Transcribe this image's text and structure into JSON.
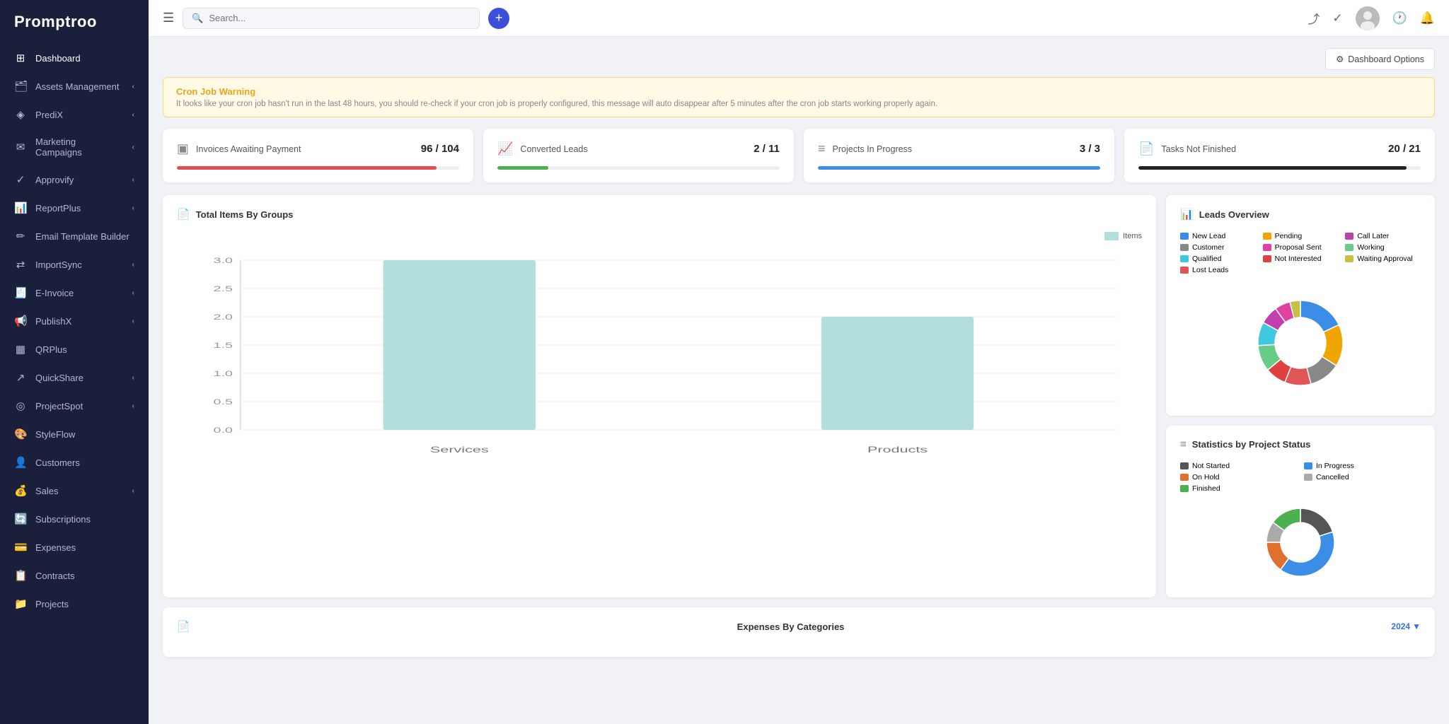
{
  "sidebar": {
    "logo": "Promptroo",
    "items": [
      {
        "id": "dashboard",
        "label": "Dashboard",
        "icon": "⊞",
        "has_arrow": false,
        "active": true
      },
      {
        "id": "assets-management",
        "label": "Assets Management",
        "icon": "🗂",
        "has_arrow": true
      },
      {
        "id": "predix",
        "label": "PrediX",
        "icon": "◈",
        "has_arrow": true
      },
      {
        "id": "marketing-campaigns",
        "label": "Marketing Campaigns",
        "icon": "✉",
        "has_arrow": true
      },
      {
        "id": "approvify",
        "label": "Approvify",
        "icon": "✓",
        "has_arrow": true
      },
      {
        "id": "reportplus",
        "label": "ReportPlus",
        "icon": "📊",
        "has_arrow": true
      },
      {
        "id": "email-template-builder",
        "label": "Email Template Builder",
        "icon": "✏",
        "has_arrow": false
      },
      {
        "id": "importsync",
        "label": "ImportSync",
        "icon": "⇄",
        "has_arrow": true
      },
      {
        "id": "e-invoice",
        "label": "E-Invoice",
        "icon": "🧾",
        "has_arrow": true
      },
      {
        "id": "publishx",
        "label": "PublishX",
        "icon": "📢",
        "has_arrow": true
      },
      {
        "id": "qrplus",
        "label": "QRPlus",
        "icon": "▦",
        "has_arrow": false
      },
      {
        "id": "quickshare",
        "label": "QuickShare",
        "icon": "↗",
        "has_arrow": true
      },
      {
        "id": "projectspot",
        "label": "ProjectSpot",
        "icon": "◎",
        "has_arrow": true
      },
      {
        "id": "styleflow",
        "label": "StyleFlow",
        "icon": "🎨",
        "has_arrow": false
      },
      {
        "id": "customers",
        "label": "Customers",
        "icon": "👤",
        "has_arrow": false
      },
      {
        "id": "sales",
        "label": "Sales",
        "icon": "💰",
        "has_arrow": true
      },
      {
        "id": "subscriptions",
        "label": "Subscriptions",
        "icon": "🔄",
        "has_arrow": false
      },
      {
        "id": "expenses",
        "label": "Expenses",
        "icon": "💳",
        "has_arrow": false
      },
      {
        "id": "contracts",
        "label": "Contracts",
        "icon": "📋",
        "has_arrow": false
      },
      {
        "id": "projects",
        "label": "Projects",
        "icon": "📁",
        "has_arrow": false
      }
    ]
  },
  "topbar": {
    "search_placeholder": "Search...",
    "add_button_label": "+",
    "dashboard_options_label": "Dashboard Options"
  },
  "warning": {
    "title": "Cron Job Warning",
    "text": "It looks like your cron job hasn't run in the last 48 hours, you should re-check if your cron job is properly configured, this message will auto disappear after 5 minutes after the cron job starts working properly again."
  },
  "kpi_cards": [
    {
      "id": "invoices-awaiting",
      "icon": "▣",
      "title": "Invoices Awaiting Payment",
      "value": "96 / 104",
      "bar_color": "#e05050",
      "bar_pct": 92
    },
    {
      "id": "converted-leads",
      "icon": "📈",
      "title": "Converted Leads",
      "value": "2 / 11",
      "bar_color": "#4caf50",
      "bar_pct": 18
    },
    {
      "id": "projects-in-progress",
      "icon": "≡",
      "title": "Projects In Progress",
      "value": "3 / 3",
      "bar_color": "#3b8de8",
      "bar_pct": 100
    },
    {
      "id": "tasks-not-finished",
      "icon": "📄",
      "title": "Tasks Not Finished",
      "value": "20 / 21",
      "bar_color": "#222",
      "bar_pct": 95
    }
  ],
  "bar_chart": {
    "title": "Total Items By Groups",
    "icon": "📄",
    "legend_label": "Items",
    "legend_color": "#b2dfdb",
    "y_labels": [
      "3.0",
      "2.5",
      "2.0",
      "1.5",
      "1.0",
      "0.5",
      "0"
    ],
    "bars": [
      {
        "label": "Services",
        "value": 3.0,
        "height_pct": 100
      },
      {
        "label": "Products",
        "value": 2.0,
        "height_pct": 66
      }
    ],
    "bar_color": "#b2dfdb"
  },
  "leads_overview": {
    "title": "Leads Overview",
    "icon": "📊",
    "legend": [
      {
        "label": "New Lead",
        "color": "#3b8de8"
      },
      {
        "label": "Pending",
        "color": "#f0a500"
      },
      {
        "label": "Call Later",
        "color": "#c040b0"
      },
      {
        "label": "Customer",
        "color": "#888"
      },
      {
        "label": "Proposal Sent",
        "color": "#e040a0"
      },
      {
        "label": "Working",
        "color": "#66cc88"
      },
      {
        "label": "Qualified",
        "color": "#40c8e0"
      },
      {
        "label": "Not Interested",
        "color": "#e04040"
      },
      {
        "label": "Waiting Approval",
        "color": "#c8c040"
      },
      {
        "label": "Lost Leads",
        "color": "#e05555"
      }
    ],
    "donut_segments": [
      {
        "label": "New Lead",
        "color": "#3b8de8",
        "pct": 18
      },
      {
        "label": "Pending",
        "color": "#f0a500",
        "pct": 16
      },
      {
        "label": "Customer",
        "color": "#888",
        "pct": 12
      },
      {
        "label": "Lost Leads",
        "color": "#e05555",
        "pct": 10
      },
      {
        "label": "Not Interested",
        "color": "#e04040",
        "pct": 8
      },
      {
        "label": "Working",
        "color": "#66cc88",
        "pct": 10
      },
      {
        "label": "Qualified",
        "color": "#40c8e0",
        "pct": 9
      },
      {
        "label": "Call Later",
        "color": "#c040b0",
        "pct": 7
      },
      {
        "label": "Proposal Sent",
        "color": "#e040a0",
        "pct": 6
      },
      {
        "label": "Waiting Approval",
        "color": "#c8c040",
        "pct": 4
      }
    ]
  },
  "project_stats": {
    "title": "Statistics by Project Status",
    "icon": "≡",
    "legend": [
      {
        "label": "Not Started",
        "color": "#555"
      },
      {
        "label": "In Progress",
        "color": "#3b8de8"
      },
      {
        "label": "On Hold",
        "color": "#e07030"
      },
      {
        "label": "Cancelled",
        "color": "#aaa"
      },
      {
        "label": "Finished",
        "color": "#4caf50"
      }
    ]
  },
  "expenses_chart": {
    "title": "Expenses By Categories",
    "icon": "📄",
    "year": "2024",
    "year_arrow": "▼"
  }
}
